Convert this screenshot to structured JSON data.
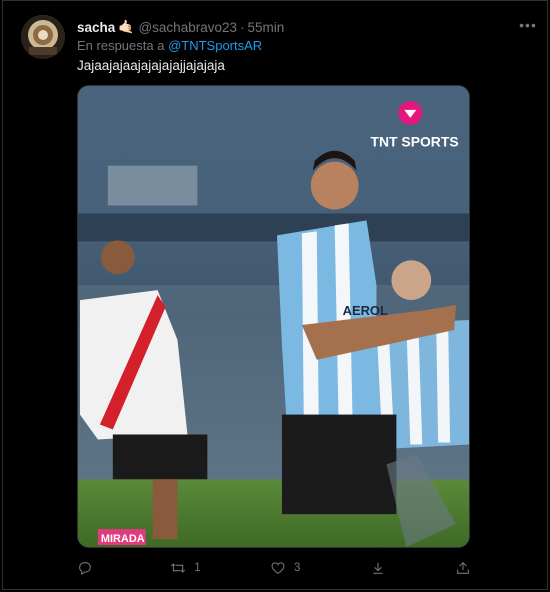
{
  "tweet": {
    "display_name": "sacha",
    "name_emoji": "🤙🏻",
    "handle": "@sachabravo23",
    "separator": "·",
    "time": "55min",
    "reply_prefix": "En respuesta a",
    "reply_to": "@TNTSportsAR",
    "text": "Jajaajajaajajajajajjajajaja",
    "more_icon": "more-dots-icon"
  },
  "media": {
    "broadcaster_logo": "TNT SPORTS",
    "sponsor_on_shirt": "AEROL",
    "watermark": "MIRADA"
  },
  "actions": {
    "reply": {
      "icon": "reply-icon",
      "count": ""
    },
    "retweet": {
      "icon": "retweet-icon",
      "count": "1"
    },
    "like": {
      "icon": "heart-icon",
      "count": "3"
    },
    "bookmark": {
      "icon": "download-icon",
      "count": ""
    },
    "share": {
      "icon": "share-icon",
      "count": ""
    }
  },
  "colors": {
    "background": "#000000",
    "text_primary": "#e7e9ea",
    "text_secondary": "#71767b",
    "link": "#1d9bf0"
  }
}
